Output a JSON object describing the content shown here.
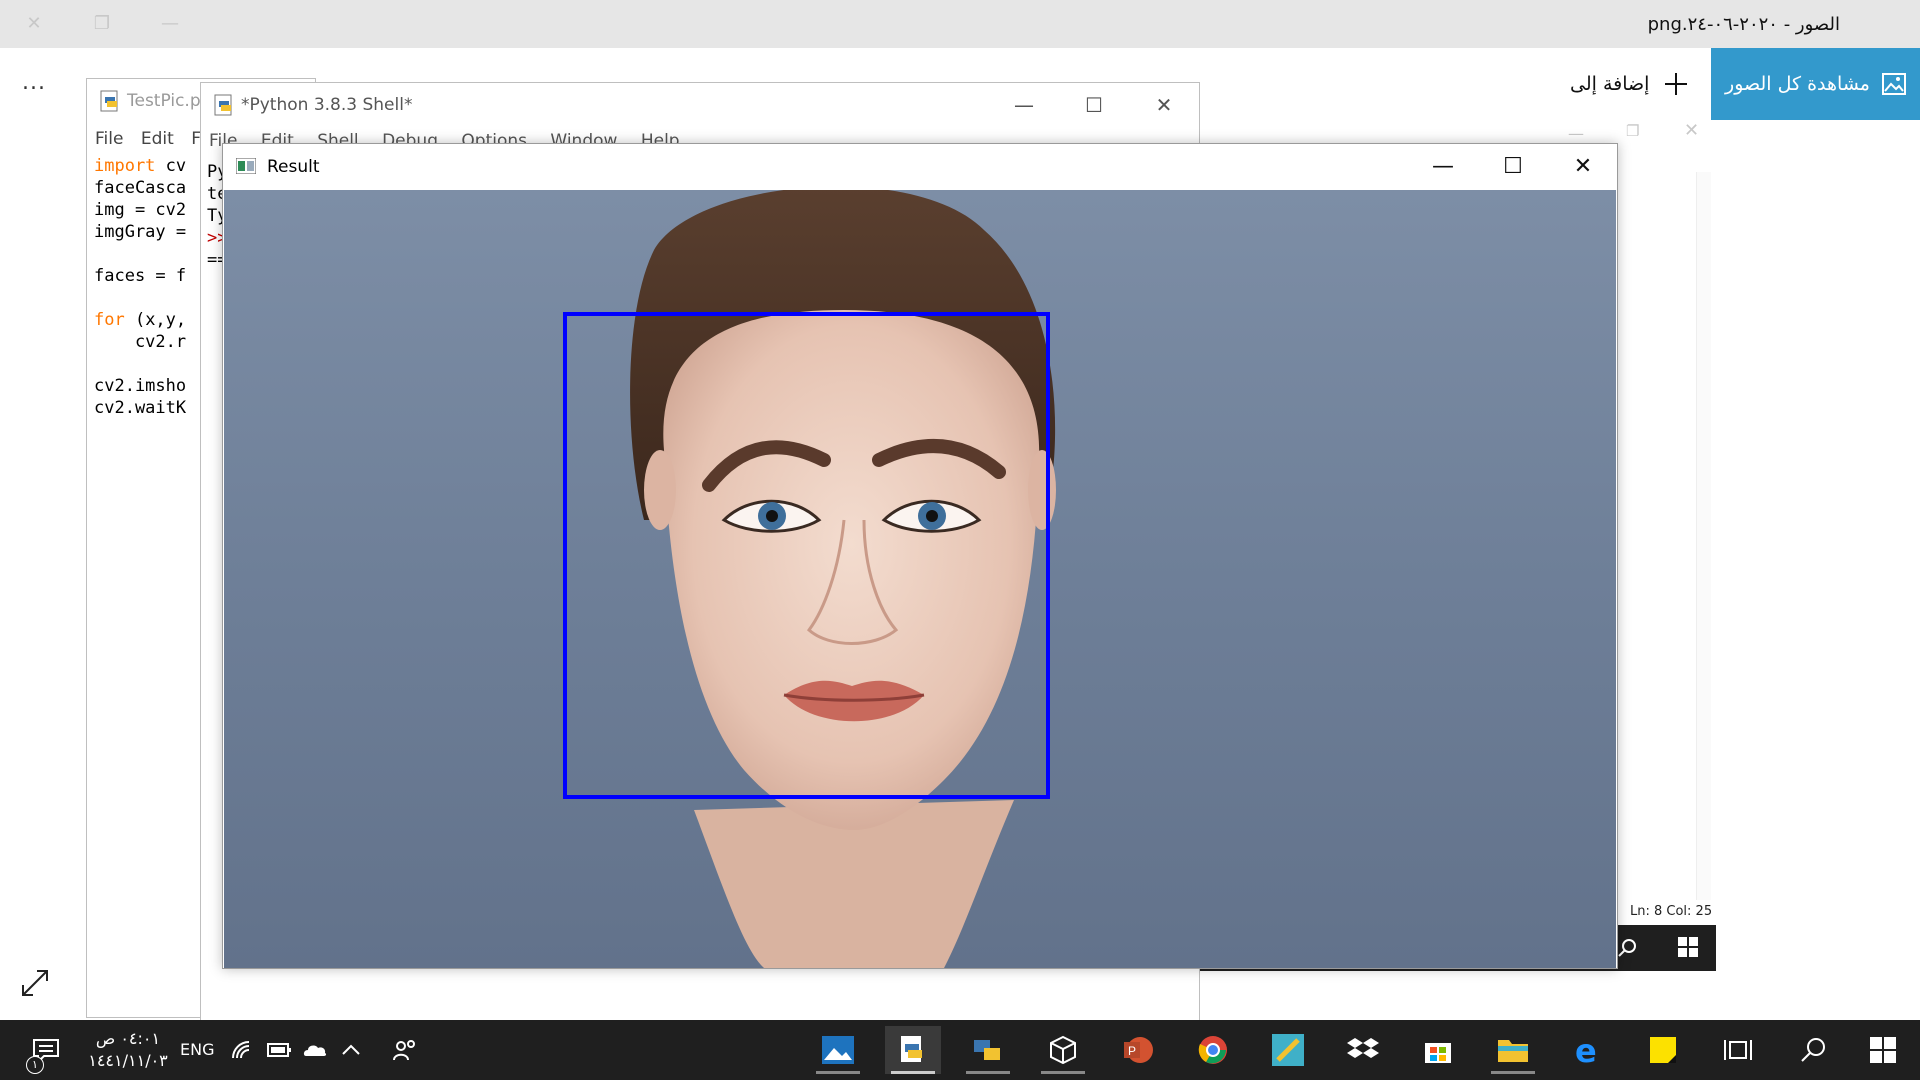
{
  "photos": {
    "title": "الصور - ٢٠٢٠-٠٦-٢٤.png",
    "view_all_label": "مشاهدة كل الصور",
    "add_to_label": "إضافة إلى",
    "more_label": "..."
  },
  "testpic": {
    "title": "TestPic.py",
    "menu": [
      "File",
      "Edit",
      "Fo"
    ],
    "code_lines": [
      {
        "kw": "import",
        "rest": " cv"
      },
      {
        "kw": "",
        "rest": "faceCasca"
      },
      {
        "kw": "",
        "rest": "img = cv2"
      },
      {
        "kw": "",
        "rest": "imgGray ="
      },
      {
        "kw": "",
        "rest": ""
      },
      {
        "kw": "",
        "rest": "faces = f"
      },
      {
        "kw": "",
        "rest": ""
      },
      {
        "kw": "for",
        "rest": " (x,y,"
      },
      {
        "kw": "",
        "rest": "    cv2.r"
      },
      {
        "kw": "",
        "rest": ""
      },
      {
        "kw": "",
        "rest": "cv2.imsho"
      },
      {
        "kw": "",
        "rest": "cv2.waitK"
      }
    ]
  },
  "shell": {
    "title": "*Python 3.8.3 Shell*",
    "menu": [
      "File",
      "Edit",
      "Shell",
      "Debug",
      "Options",
      "Window",
      "Help"
    ],
    "text_lines": [
      "Py",
      "te",
      "Ty",
      ">>",
      "=="
    ]
  },
  "side": {
    "status": "Ln: 8  Col: 25"
  },
  "result": {
    "title": "Result"
  },
  "taskbar": {
    "clock_time": "٠٤:٠١ ص",
    "clock_date": "١٤٤١/١١/٠٣",
    "lang": "ENG",
    "notification_count": "١"
  },
  "colors": {
    "accent": "#3399cc",
    "face_box": "#0000ff",
    "taskbar": "#1f1f1f"
  }
}
